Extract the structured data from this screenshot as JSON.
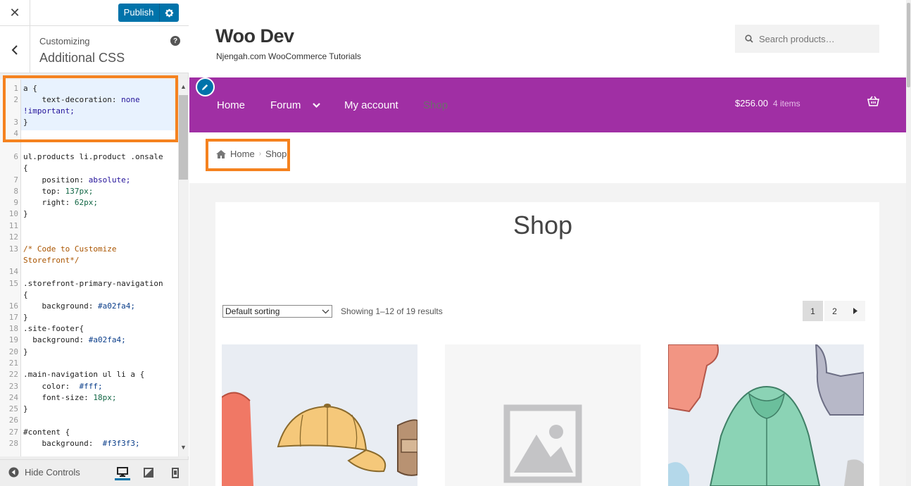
{
  "customizer": {
    "close_icon": "close-icon",
    "publish_label": "Publish",
    "gear_icon": "gear-icon",
    "section_small": "Customizing",
    "section_title": "Additional CSS",
    "help_label": "?",
    "hide_controls_label": "Hide Controls",
    "accent_color": "#0073aa"
  },
  "css_editor": {
    "line_numbers": [
      "1",
      "2",
      "",
      "3",
      "4",
      "",
      "6",
      "",
      "7",
      "8",
      "9",
      "10",
      "11",
      "12",
      "13",
      "",
      "14",
      "15",
      "",
      "16",
      "17",
      "18",
      "19",
      "20",
      "21",
      "22",
      "23",
      "24",
      "25",
      "26",
      "27",
      "28"
    ],
    "lines": [
      "a {",
      "    text-decoration: none",
      "!important;",
      "}",
      "",
      "ul.products li.product .onsale",
      "{",
      "    position: absolute;",
      "    top: 137px;",
      "    right: 62px;",
      "}",
      "",
      "",
      "/* Code to Customize",
      "Storefront*/",
      "",
      ".storefront-primary-navigation",
      "{",
      "    background: #a02fa4;",
      "}",
      ".site-footer{",
      "  background: #a02fa4;",
      "}",
      "",
      ".main-navigation ul li a {",
      "    color:  #fff;",
      "    font-size: 18px;",
      "}",
      "",
      "#content {",
      "    background:  #f3f3f3;"
    ]
  },
  "site": {
    "title": "Woo Dev",
    "tagline": "Njengah.com WooCommerce Tutorials",
    "search_placeholder": "Search products…",
    "nav_color": "#a02fa4",
    "nav": [
      {
        "label": "Home"
      },
      {
        "label": "Forum"
      },
      {
        "label": "My account"
      },
      {
        "label": "Shop"
      }
    ],
    "cart_amount": "$256.00",
    "cart_items": "4 items",
    "breadcrumb": {
      "home": "Home",
      "current": "Shop"
    },
    "page_heading": "Shop",
    "sort_selected": "Default sorting",
    "result_count": "Showing 1–12 of 19 results",
    "pagination": [
      "1",
      "2"
    ],
    "highlight_color": "#f5821f"
  }
}
